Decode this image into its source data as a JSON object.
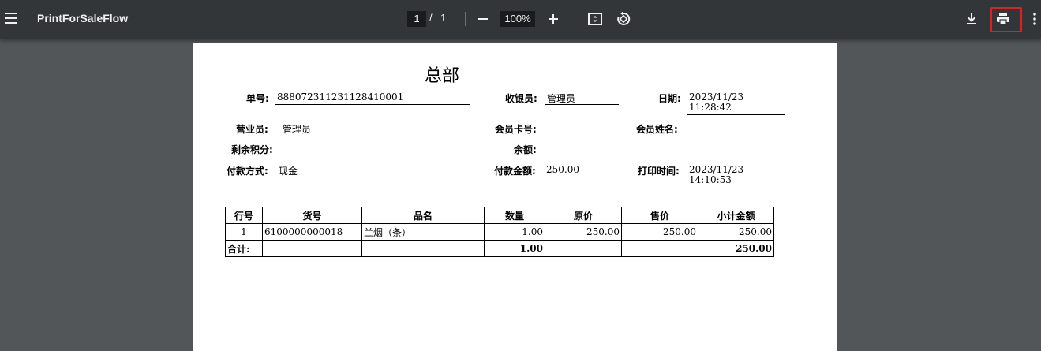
{
  "toolbar": {
    "title": "PrintForSaleFlow",
    "page_current": "1",
    "page_separator": "/",
    "page_total": "1",
    "zoom": "100%"
  },
  "receipt": {
    "title": "总部",
    "order_no_label": "单号:",
    "order_no": "888072311231128410001",
    "cashier_label": "收银员:",
    "cashier": "管理员",
    "date_label": "日期:",
    "date_line1": "2023/11/23",
    "date_line2": "11:28:42",
    "salesperson_label": "营业员:",
    "salesperson": "管理员",
    "member_card_label": "会员卡号:",
    "member_card": "",
    "member_name_label": "会员姓名:",
    "member_name": "",
    "points_label": "剩余积分:",
    "points": "",
    "balance_label": "余额:",
    "balance": "",
    "pay_method_label": "付款方式:",
    "pay_method": "现金",
    "pay_amount_label": "付款金额:",
    "pay_amount": "250.00",
    "print_time_label": "打印时间:",
    "print_time_line1": "2023/11/23",
    "print_time_line2": "14:10:53"
  },
  "table": {
    "headers": [
      "行号",
      "货号",
      "品名",
      "数量",
      "原价",
      "售价",
      "小计金额"
    ],
    "rows": [
      [
        "1",
        "6100000000018",
        "兰烟（条）",
        "1.00",
        "250.00",
        "250.00",
        "250.00"
      ]
    ],
    "total_label": "合计:",
    "total_qty": "1.00",
    "total_amount": "250.00"
  },
  "colors": {
    "toolbar_bg": "#323639",
    "viewer_bg": "#525659",
    "highlight": "#e02020"
  }
}
